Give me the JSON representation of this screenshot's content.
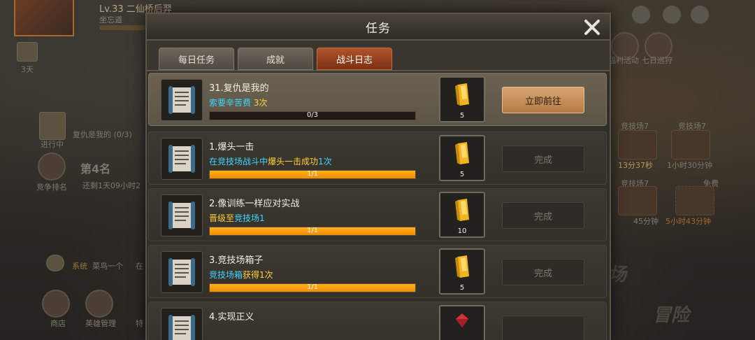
{
  "background": {
    "player_level": "Lv.33",
    "player_name": "二仙桥后羿",
    "player_sub": "坐忘道",
    "days_label": "3天",
    "side_task_text": "复仇是我的 (0/3)",
    "side_task_status": "进行中",
    "rank_label": "竞争排名",
    "rank_value": "第4名",
    "rank_time": "还剩1天09小时2",
    "chat_channel": "系统",
    "chat_text": "菜鸟一个",
    "chat_more": "在",
    "bottom_shop": "商店",
    "bottom_heroes": "英雄管理",
    "bottom_special": "特",
    "welfare": "福利活动",
    "seven_day": "七日巡狩",
    "arena_chest_1": "竞技场7",
    "arena_chest_2": "竞技场7",
    "arena_chest_3": "竞技场7",
    "free_label": "免费",
    "timer_1": "13分37秒",
    "timer_2": "1小时30分钟",
    "timer_3": "45分钟",
    "timer_4": "5小时43分钟",
    "adventure": "冒险",
    "arena_big": "场"
  },
  "dialog": {
    "title": "任务",
    "tabs": [
      {
        "label": "每日任务",
        "active": false
      },
      {
        "label": "成就",
        "active": false
      },
      {
        "label": "战斗日志",
        "active": true
      }
    ],
    "tasks": [
      {
        "title": "31.复仇是我的",
        "desc_a": "索要辛苦费",
        "desc_b": " 3次",
        "progress_text": "0/3",
        "progress": 0,
        "reward_count": "5",
        "reward_icon": "gold-bar-icon",
        "button": "立即前往",
        "state": "go"
      },
      {
        "title": "1.爆头一击",
        "desc_a": "在竞技场战斗中",
        "desc_b": "爆头一击成功",
        "desc_c": "1次",
        "progress_text": "1/1",
        "progress": 1,
        "reward_count": "5",
        "reward_icon": "gold-bar-icon",
        "button": "完成",
        "state": "done"
      },
      {
        "title": "2.像训练一样应对实战",
        "desc_a": "晋级至",
        "desc_b": "竞技场1",
        "progress_text": "1/1",
        "progress": 1,
        "reward_count": "10",
        "reward_icon": "gold-bar-icon",
        "button": "完成",
        "state": "done"
      },
      {
        "title": "3.竞技场箱子",
        "desc_a": "竞技场箱",
        "desc_b": "获得1次",
        "progress_text": "1/1",
        "progress": 1,
        "reward_count": "5",
        "reward_icon": "gold-bar-icon",
        "button": "完成",
        "state": "done"
      },
      {
        "title": "4.实现正义",
        "reward_icon": "gem-icon"
      }
    ]
  },
  "colors": {
    "accent_tab": "#b0532c",
    "progress": "#f5a000",
    "desc_cyan": "#3ed7ff",
    "desc_yellow": "#ffd23a",
    "go_button": "#c48e58"
  }
}
